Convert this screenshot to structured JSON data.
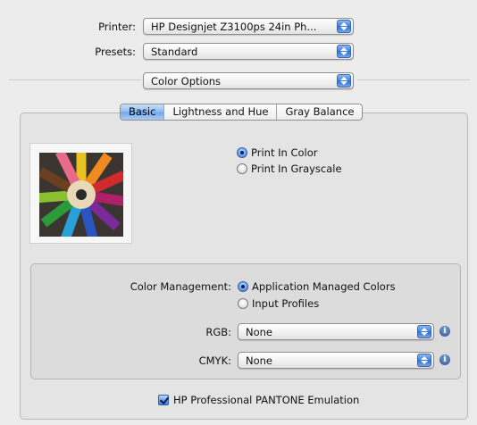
{
  "printer": {
    "label": "Printer:",
    "value": "HP Designjet Z3100ps 24in Ph..."
  },
  "presets": {
    "label": "Presets:",
    "value": "Standard"
  },
  "pane": {
    "value": "Color Options"
  },
  "tabs": [
    "Basic",
    "Lightness and Hue",
    "Gray Balance"
  ],
  "print_mode": {
    "options": [
      "Print In Color",
      "Print In Grayscale"
    ],
    "selected": "Print In Color"
  },
  "color_management": {
    "label": "Color Management:",
    "options": [
      "Application Managed Colors",
      "Input Profiles"
    ],
    "selected": "Application Managed Colors",
    "rgb": {
      "label": "RGB:",
      "value": "None"
    },
    "cmyk": {
      "label": "CMYK:",
      "value": "None"
    }
  },
  "pantone": {
    "label": "HP Professional PANTONE Emulation",
    "checked": true
  },
  "icons": {
    "popup_arrows": "updown-arrows-icon",
    "info": "info-icon",
    "preview": "color-pencils-preview"
  },
  "colors": {
    "accent": "#3d7de0",
    "panel": "#e4e4e4",
    "background": "#ececec"
  }
}
